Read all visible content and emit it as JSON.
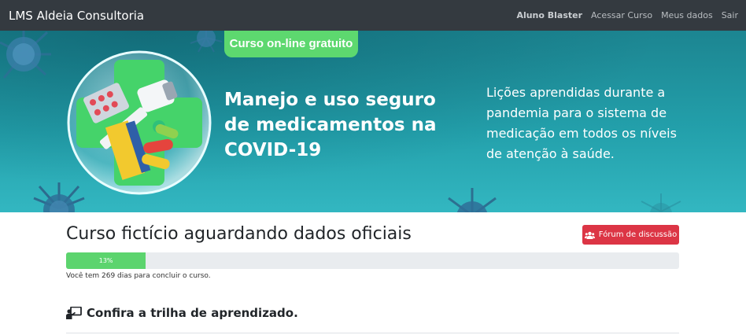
{
  "navbar": {
    "brand": "LMS Aldeia Consultoria",
    "user": "Aluno Blaster",
    "links": [
      "Acessar Curso",
      "Meus dados",
      "Sair"
    ]
  },
  "banner": {
    "badge": "Curso on-line gratuito",
    "headline": "Manejo e uso seguro de medicamentos na COVID-19",
    "description": "Lições aprendidas durante a pandemia para o sistema de medicação em todos os níveis de atenção à saúde."
  },
  "course": {
    "title": "Curso fictício aguardando dados oficiais",
    "forum_label": "Fórum de discussão",
    "progress_percent": 13,
    "progress_label": "13%",
    "days_text": "Você tem 269 dias para concluir o curso.",
    "trail_heading": "Confira a trilha de aprendizado."
  },
  "colors": {
    "navbar": "#343a40",
    "banner": "#23a0ab",
    "badge": "#5dd86f",
    "forum_button": "#dc3545",
    "progress": "#5cd46e"
  },
  "icons": {
    "forum": "users-icon",
    "trail": "chalkboard-teacher-icon"
  }
}
